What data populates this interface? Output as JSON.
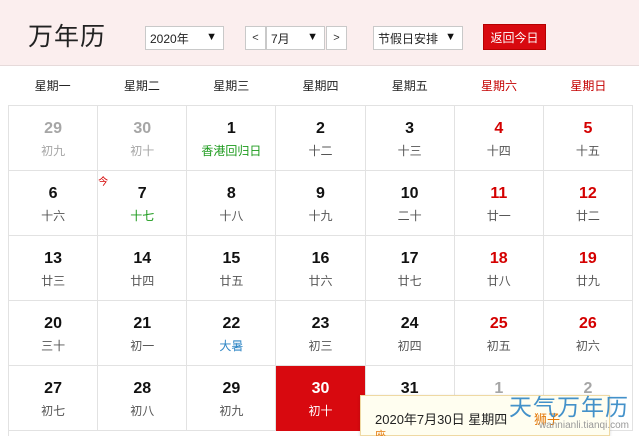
{
  "header": {
    "brand": "万年历",
    "year_select": "2020年",
    "month_select": "7月",
    "prev_label": "<",
    "next_label": ">",
    "holiday_select": "节假日安排",
    "today_button": "返回今日",
    "dropdown_arrow": "▼"
  },
  "weekdays": [
    "星期一",
    "星期二",
    "星期三",
    "星期四",
    "星期五",
    "星期六",
    "星期日"
  ],
  "weeks": [
    [
      {
        "day": "29",
        "lunar": "初九",
        "type": "other"
      },
      {
        "day": "30",
        "lunar": "初十",
        "type": "other"
      },
      {
        "day": "1",
        "lunar": "香港回归日",
        "type": "festival"
      },
      {
        "day": "2",
        "lunar": "十二",
        "type": ""
      },
      {
        "day": "3",
        "lunar": "十三",
        "type": ""
      },
      {
        "day": "4",
        "lunar": "十四",
        "type": "weekend"
      },
      {
        "day": "5",
        "lunar": "十五",
        "type": "weekend"
      }
    ],
    [
      {
        "day": "6",
        "lunar": "十六",
        "type": ""
      },
      {
        "day": "7",
        "lunar": "十七",
        "type": "holiday",
        "mark": "今"
      },
      {
        "day": "8",
        "lunar": "十八",
        "type": ""
      },
      {
        "day": "9",
        "lunar": "十九",
        "type": ""
      },
      {
        "day": "10",
        "lunar": "二十",
        "type": ""
      },
      {
        "day": "11",
        "lunar": "廿一",
        "type": "weekend"
      },
      {
        "day": "12",
        "lunar": "廿二",
        "type": "weekend"
      }
    ],
    [
      {
        "day": "13",
        "lunar": "廿三",
        "type": ""
      },
      {
        "day": "14",
        "lunar": "廿四",
        "type": ""
      },
      {
        "day": "15",
        "lunar": "廿五",
        "type": ""
      },
      {
        "day": "16",
        "lunar": "廿六",
        "type": ""
      },
      {
        "day": "17",
        "lunar": "廿七",
        "type": ""
      },
      {
        "day": "18",
        "lunar": "廿八",
        "type": "weekend"
      },
      {
        "day": "19",
        "lunar": "廿九",
        "type": "weekend"
      }
    ],
    [
      {
        "day": "20",
        "lunar": "三十",
        "type": ""
      },
      {
        "day": "21",
        "lunar": "初一",
        "type": ""
      },
      {
        "day": "22",
        "lunar": "大暑",
        "type": "term"
      },
      {
        "day": "23",
        "lunar": "初三",
        "type": ""
      },
      {
        "day": "24",
        "lunar": "初四",
        "type": ""
      },
      {
        "day": "25",
        "lunar": "初五",
        "type": "weekend"
      },
      {
        "day": "26",
        "lunar": "初六",
        "type": "weekend"
      }
    ],
    [
      {
        "day": "27",
        "lunar": "初七",
        "type": ""
      },
      {
        "day": "28",
        "lunar": "初八",
        "type": ""
      },
      {
        "day": "29",
        "lunar": "初九",
        "type": ""
      },
      {
        "day": "30",
        "lunar": "初十",
        "type": "selected"
      },
      {
        "day": "31",
        "lunar": "",
        "type": ""
      },
      {
        "day": "1",
        "lunar": "",
        "type": "other"
      },
      {
        "day": "2",
        "lunar": "",
        "type": "other"
      }
    ]
  ],
  "popup": {
    "date_text": "2020年7月30日 星期四",
    "zodiac": "狮子",
    "extra": "座"
  },
  "watermark": {
    "title": "天气万年历",
    "url": "wannianli.tianqi.com"
  },
  "colors": {
    "accent_red": "#d8090f",
    "header_bg": "#fbeeee",
    "festival_green": "#1c9a1c",
    "term_blue": "#2f86c5",
    "zodiac_orange": "#e4780a"
  }
}
